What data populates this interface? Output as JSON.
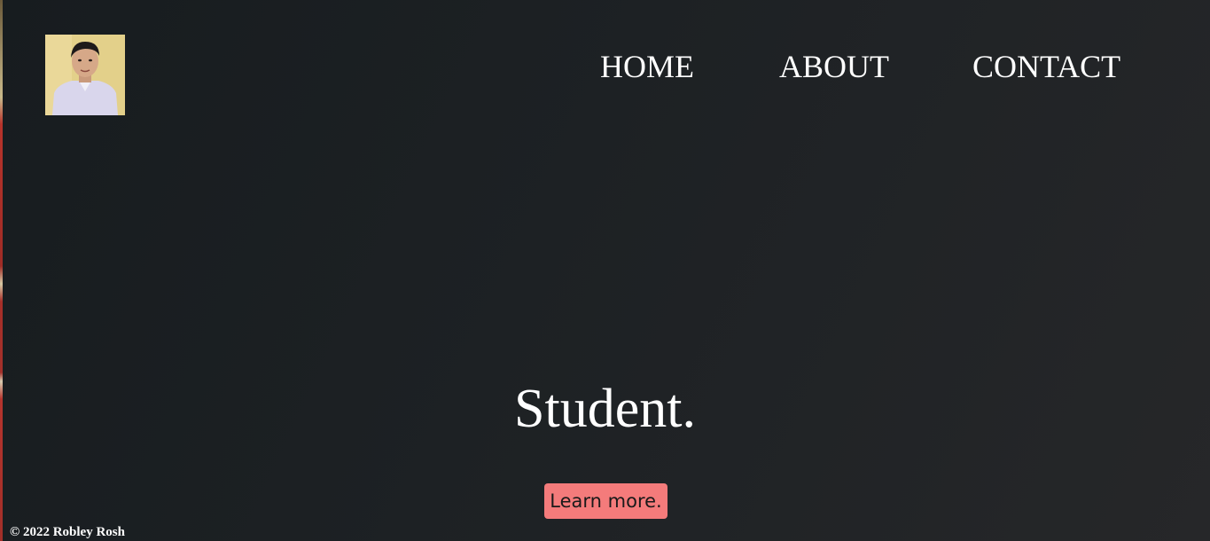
{
  "header": {
    "avatar_alt": "profile photo",
    "nav": {
      "home": "HOME",
      "about": "ABOUT",
      "contact": "CONTACT"
    }
  },
  "hero": {
    "title": "Student.",
    "cta_label": "Learn more."
  },
  "footer": {
    "copyright": "© 2022 Robley Rosh"
  },
  "colors": {
    "background": "#1d2124",
    "cta": "#f47b7b",
    "text": "#ffffff"
  }
}
